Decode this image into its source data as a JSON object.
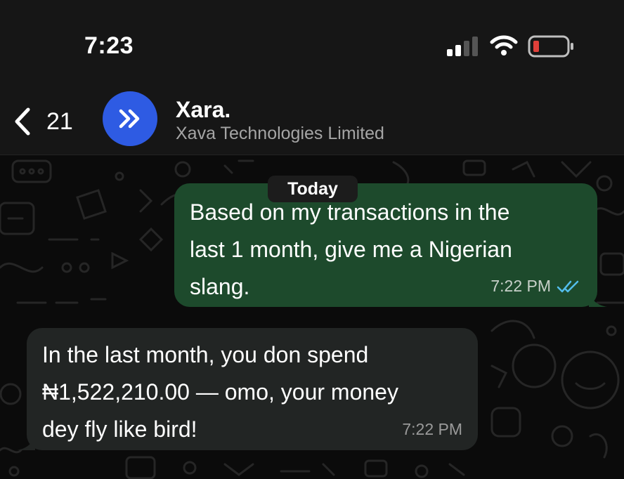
{
  "status_bar": {
    "time": "7:23",
    "icons": [
      "signal-icon",
      "wifi-icon",
      "battery-icon"
    ],
    "battery_color": "#e0403a"
  },
  "header": {
    "back_count": "21",
    "contact_name": "Xara.",
    "contact_subtitle": "Xava Technologies Limited",
    "avatar_color": "#2e5be3",
    "avatar_icon": "double-chevron-right-icon"
  },
  "chat": {
    "date_label": "Today",
    "messages": [
      {
        "direction": "outgoing",
        "lines": [
          "Based on my transactions in the",
          "last 1 month, give me a Nigerian",
          "slang."
        ],
        "time": "7:22 PM",
        "status_icon": "read-double-tick-icon",
        "bubble_color": "#1d4a2c",
        "tick_color": "#53bdeb"
      },
      {
        "direction": "incoming",
        "lines": [
          "In the last month, you don spend",
          "₦1,522,210.00 — omo, your money",
          "dey fly like bird!"
        ],
        "time": "7:22 PM",
        "bubble_color": "#222524"
      }
    ]
  }
}
